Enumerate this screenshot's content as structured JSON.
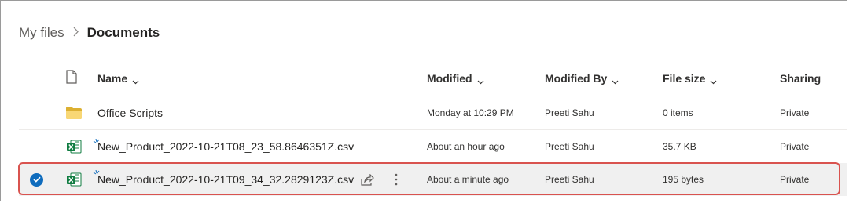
{
  "breadcrumb": {
    "parent": "My files",
    "separator": ">",
    "current": "Documents"
  },
  "columns": {
    "name": "Name",
    "modified": "Modified",
    "modified_by": "Modified By",
    "file_size": "File size",
    "sharing": "Sharing"
  },
  "rows": [
    {
      "type": "folder",
      "name": "Office Scripts",
      "modified": "Monday at 10:29 PM",
      "modified_by": "Preeti Sahu",
      "file_size": "0 items",
      "sharing": "Private",
      "selected": false
    },
    {
      "type": "excel",
      "name": "New_Product_2022-10-21T08_23_58.8646351Z.csv",
      "modified": "About an hour ago",
      "modified_by": "Preeti Sahu",
      "file_size": "35.7 KB",
      "sharing": "Private",
      "selected": false
    },
    {
      "type": "excel",
      "name": "New_Product_2022-10-21T09_34_32.2829123Z.csv",
      "modified": "About a minute ago",
      "modified_by": "Preeti Sahu",
      "file_size": "195 bytes",
      "sharing": "Private",
      "selected": true
    }
  ],
  "colors": {
    "accent": "#0f6cbd",
    "excel_green": "#107c41",
    "folder_yellow": "#f8d775",
    "highlight_outline": "#d9534f"
  }
}
